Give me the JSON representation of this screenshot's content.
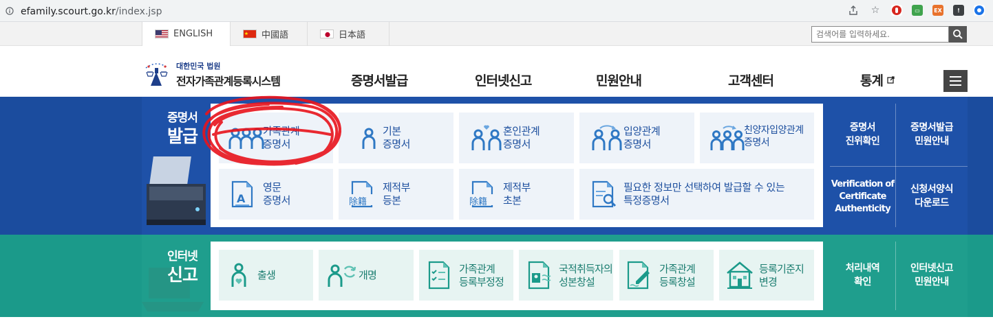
{
  "browser": {
    "url_host": "efamily.scourt.go.kr",
    "url_path": "/index.jsp",
    "icons": [
      "share-icon",
      "star-icon",
      "extension-red-icon",
      "extension-green-icon",
      "extension-ex-icon",
      "extension-dark-icon",
      "profile-icon"
    ]
  },
  "lang_bar": {
    "items": [
      {
        "label": "ENGLISH",
        "flag": "us"
      },
      {
        "label": "中國語",
        "flag": "cn"
      },
      {
        "label": "日本語",
        "flag": "jp"
      }
    ],
    "search_placeholder": "검색어를 입력하세요."
  },
  "header": {
    "logo_sub": "대한민국 법원",
    "logo_main": "전자가족관계등록시스템",
    "nav": [
      "증명서발급",
      "인터넷신고",
      "민원안내",
      "고객센터",
      "통계"
    ]
  },
  "certificates": {
    "title_line1": "증명서",
    "title_line2": "발급",
    "tiles": [
      {
        "line1": "가족관계",
        "line2": "증명서",
        "icon": "family-icon"
      },
      {
        "line1": "기본",
        "line2": "증명서",
        "icon": "person-icon"
      },
      {
        "line1": "혼인관계",
        "line2": "증명서",
        "icon": "marriage-icon"
      },
      {
        "line1": "입양관계",
        "line2": "증명서",
        "icon": "adoption-icon"
      },
      {
        "line1": "친양자입양관계",
        "line2": "증명서",
        "icon": "full-adoption-icon"
      },
      {
        "line1": "영문",
        "line2": "증명서",
        "icon": "english-doc-icon"
      },
      {
        "line1": "제적부",
        "line2": "등본",
        "icon": "removed-register-icon",
        "badge": "除籍"
      },
      {
        "line1": "제적부",
        "line2": "초본",
        "icon": "removed-register-icon",
        "badge": "除籍"
      },
      {
        "line1": "필요한 정보만 선택하여 발급할 수 있는",
        "line2": "특정증명서",
        "icon": "doc-search-icon"
      }
    ],
    "side": [
      {
        "line1": "증명서",
        "line2": "진위확인"
      },
      {
        "line1": "증명서발급",
        "line2": "민원안내"
      },
      {
        "line1": "Verification of",
        "line2": "Certificate",
        "line3": "Authenticity"
      },
      {
        "line1": "신청서양식",
        "line2": "다운로드"
      }
    ]
  },
  "internet_report": {
    "title_line1": "인터넷",
    "title_line2": "신고",
    "tiles": [
      {
        "line1": "출생",
        "line2": "",
        "icon": "birth-icon"
      },
      {
        "line1": "개명",
        "line2": "",
        "icon": "rename-icon"
      },
      {
        "line1": "가족관계",
        "line2": "등록부정정",
        "icon": "checklist-icon"
      },
      {
        "line1": "국적취득자의",
        "line2": "성본창설",
        "icon": "id-card-icon"
      },
      {
        "line1": "가족관계",
        "line2": "등록창설",
        "icon": "doc-edit-icon"
      },
      {
        "line1": "등록기준지",
        "line2": "변경",
        "icon": "house-icon"
      }
    ],
    "side": [
      {
        "line1": "처리내역",
        "line2": "확인"
      },
      {
        "line1": "인터넷신고",
        "line2": "민원안내"
      }
    ]
  },
  "colors": {
    "blue_band": "#1e51a8",
    "green_band": "#1f9e8d",
    "tile_text_blue": "#1d4f9e",
    "tile_text_green": "#1b7d70",
    "scribble": "#e8141c"
  }
}
